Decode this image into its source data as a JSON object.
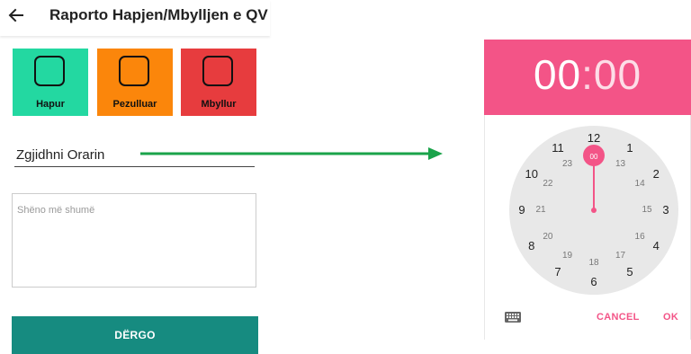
{
  "app": {
    "title": "Raporto Hapjen/Mbylljen e QV",
    "back_icon": "arrow-left-icon"
  },
  "status_tiles": [
    {
      "label": "Hapur",
      "color": "#23d8a1"
    },
    {
      "label": "Pezulluar",
      "color": "#fb860b"
    },
    {
      "label": "Mbyllur",
      "color": "#e73c3e"
    }
  ],
  "time_field": {
    "value": "Zgjidhni Orarin"
  },
  "notes": {
    "placeholder": "Shëno më shumë"
  },
  "submit": {
    "label": "DËRGO",
    "color": "#168b80"
  },
  "arrow": {
    "color": "#1aa34a"
  },
  "time_picker": {
    "hours": "00",
    "separator": ":",
    "minutes": "00",
    "accent": "#f35487",
    "outer_ring": [
      "12",
      "1",
      "2",
      "3",
      "4",
      "5",
      "6",
      "7",
      "8",
      "9",
      "10",
      "11"
    ],
    "inner_ring": [
      "00",
      "13",
      "14",
      "15",
      "16",
      "17",
      "18",
      "19",
      "20",
      "21",
      "22",
      "23"
    ],
    "selected": "00",
    "keyboard_icon": "keyboard-icon",
    "cancel_label": "CANCEL",
    "ok_label": "OK"
  }
}
